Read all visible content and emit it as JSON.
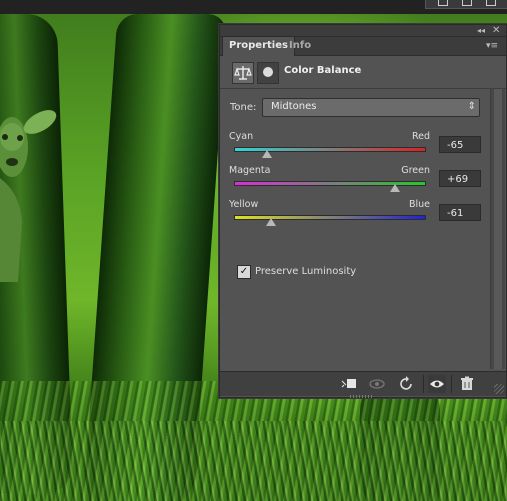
{
  "panel": {
    "tabs": [
      {
        "label": "Properties",
        "active": true
      },
      {
        "label": "Info",
        "active": false
      }
    ],
    "collapse_icon": "double-chevron-left-icon",
    "close_icon": "close-icon",
    "menu_icon": "panel-menu-icon",
    "title": "Color Balance",
    "tone": {
      "label": "Tone:",
      "value": "Midtones"
    },
    "sliders": [
      {
        "left": "Cyan",
        "right": "Red",
        "value": "-65",
        "level": -65,
        "gradient": [
          "#2fd6d6",
          "#d62424"
        ]
      },
      {
        "left": "Magenta",
        "right": "Green",
        "value": "+69",
        "level": 69,
        "gradient": [
          "#d62fd6",
          "#26c82a"
        ]
      },
      {
        "left": "Yellow",
        "right": "Blue",
        "value": "-61",
        "level": -61,
        "gradient": [
          "#e0e020",
          "#2222d2"
        ]
      }
    ],
    "preserve_luminosity": {
      "label": "Preserve Luminosity",
      "checked": true
    },
    "bottom_icons": [
      "clip-to-layer-icon",
      "view-previous-state-icon",
      "reset-icon",
      "visibility-eye-icon",
      "trash-icon"
    ]
  },
  "colors": {
    "panel_bg": "#535353",
    "tab_bar": "#3c3c3c"
  }
}
